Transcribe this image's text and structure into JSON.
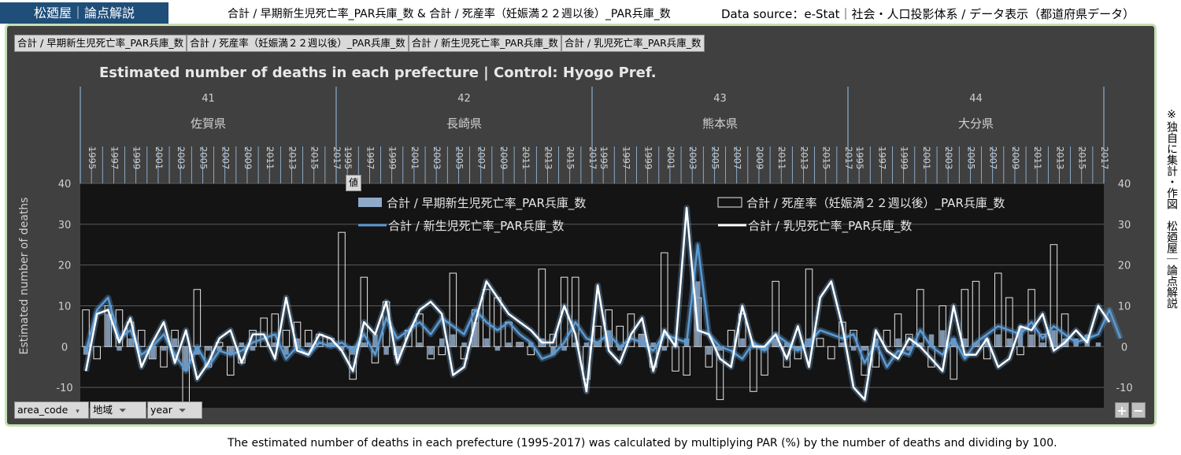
{
  "header": {
    "brand": "松廼屋｜論点解説",
    "fields": "合計 / 早期新生児死亡率_PAR兵庫_数 & 合計 / 死産率（妊娠満２２週以後）_PAR兵庫_数",
    "source": "Data source：e-Stat｜社会・人口投影体系 / データ表示（都道府県データ）"
  },
  "field_buttons": [
    "合計 / 早期新生児死亡率_PAR兵庫_数",
    "合計 / 死産率（妊娠満２２週以後）_PAR兵庫_数",
    "合計 / 新生児死亡率_PAR兵庫_数",
    "合計 / 乳児死亡率_PAR兵庫_数"
  ],
  "values_tag": "値",
  "side_credit": "※独自に集計・作図　松廼屋｜論点解説",
  "footnote": "The estimated number of deaths in each prefecture (1995-2017) was calculated by multiplying PAR (%) by the number of deaths and dividing by 100.",
  "bottom_buttons": {
    "area_code": "area_code",
    "region": "地域",
    "year": "year"
  },
  "zoom": {
    "plus": "+",
    "minus": "−"
  },
  "colors": {
    "panel": "#404040",
    "plot": "#141414",
    "bar_early": "#8fa9c9",
    "line_neonatal": "#5b9bd5",
    "line_infant": "#ffffff",
    "axis_line": "#9dc3e6"
  },
  "chart_data": {
    "type": "bar",
    "title": "Estimated number of deaths in each prefecture | Control: Hyogo Pref.",
    "ylabel": "Estimated number of deaths",
    "ylim": [
      -15,
      40
    ],
    "yticks": [
      40,
      30,
      20,
      10,
      0,
      -10
    ],
    "secondary_yticks": [
      40,
      30,
      20,
      10,
      0,
      -10
    ],
    "legend_position": "top",
    "groups": [
      {
        "code": "41",
        "name": "佐賀県",
        "years": [
          "1995",
          "1996",
          "1997",
          "1998",
          "1999",
          "2000",
          "2001",
          "2002",
          "2003",
          "2004",
          "2005",
          "2006",
          "2007",
          "2008",
          "2009",
          "2010",
          "2011",
          "2012",
          "2013",
          "2014",
          "2015",
          "2016",
          "2017"
        ]
      },
      {
        "code": "42",
        "name": "長崎県",
        "years": [
          "1995",
          "1996",
          "1997",
          "1998",
          "1999",
          "2000",
          "2001",
          "2002",
          "2003",
          "2004",
          "2005",
          "2006",
          "2007",
          "2008",
          "2009",
          "2010",
          "2011",
          "2012",
          "2013",
          "2014",
          "2015",
          "2016",
          "2017"
        ]
      },
      {
        "code": "43",
        "name": "熊本県",
        "years": [
          "1995",
          "1996",
          "1997",
          "1998",
          "1999",
          "2000",
          "2001",
          "2002",
          "2003",
          "2004",
          "2005",
          "2006",
          "2007",
          "2008",
          "2009",
          "2010",
          "2011",
          "2012",
          "2013",
          "2014",
          "2015",
          "2016",
          "2017"
        ]
      },
      {
        "code": "44",
        "name": "大分県",
        "years": [
          "1995",
          "1996",
          "1997",
          "1998",
          "1999",
          "2000",
          "2001",
          "2002",
          "2003",
          "2004",
          "2005",
          "2006",
          "2007",
          "2008",
          "2009",
          "2010",
          "2011",
          "2012",
          "2013",
          "2014",
          "2015",
          "2016",
          "2017"
        ]
      }
    ],
    "series": [
      {
        "name": "合計 / 早期新生児死亡率_PAR兵庫_数",
        "kind": "bar",
        "values": [
          -2,
          0,
          8,
          -1,
          2,
          0,
          -3,
          -1,
          2,
          -6,
          -2,
          -1,
          -1,
          -2,
          1,
          -1,
          0,
          1,
          -2,
          2,
          1,
          0,
          1,
          -1,
          -2,
          1,
          3,
          -2,
          -3,
          0,
          1,
          -2,
          2,
          3,
          1,
          6,
          2,
          -1,
          1,
          1,
          1,
          2,
          -2,
          -1,
          1,
          1,
          1,
          4,
          -1,
          0,
          3,
          1,
          -1,
          1,
          2,
          16,
          -2,
          -1,
          0,
          2,
          1,
          -1,
          2,
          1,
          -1,
          2,
          0,
          0,
          1,
          -1,
          -1,
          2,
          0,
          2,
          -1,
          1,
          3,
          4,
          2,
          2,
          1,
          2,
          3,
          2,
          5,
          3,
          1,
          4,
          2,
          2,
          3,
          1
        ]
      },
      {
        "name": "合計 / 死産率（妊娠満２２週以後）_PAR兵庫_数",
        "kind": "bar-outline",
        "values": [
          9,
          -3,
          10,
          9,
          6,
          4,
          -3,
          -5,
          4,
          -14,
          14,
          -5,
          1,
          -7,
          -4,
          4,
          7,
          8,
          4,
          6,
          4,
          3,
          2,
          28,
          -8,
          17,
          -4,
          11,
          -2,
          4,
          8,
          -3,
          -2,
          18,
          -3,
          9,
          14,
          12,
          6,
          1,
          -2,
          19,
          3,
          17,
          17,
          -8,
          5,
          9,
          5,
          8,
          3,
          -5,
          23,
          -6,
          -7,
          12,
          -5,
          -13,
          4,
          8,
          -11,
          -7,
          16,
          -5,
          -3,
          19,
          2,
          -3,
          6,
          4,
          -7,
          -5,
          4,
          8,
          3,
          14,
          -5,
          10,
          -8,
          14,
          16,
          -3,
          18,
          12,
          -2,
          14,
          3,
          25,
          8
        ]
      },
      {
        "name": "合計 / 新生児死亡率_PAR兵庫_数",
        "kind": "line",
        "values": [
          -1,
          9,
          12,
          2,
          4,
          -2,
          0,
          3,
          -2,
          -6,
          0,
          -5,
          -1,
          -2,
          -1,
          1,
          2,
          3,
          -3,
          0,
          -2,
          1,
          0,
          1,
          -1,
          3,
          -2,
          7,
          2,
          4,
          6,
          3,
          7,
          5,
          3,
          9,
          6,
          4,
          6,
          3,
          1,
          -3,
          -2,
          1,
          6,
          2,
          1,
          3,
          0,
          2,
          1,
          -1,
          3,
          2,
          1,
          25,
          3,
          0,
          -1,
          -3,
          1,
          -1,
          3,
          1,
          -1,
          1,
          4,
          3,
          2,
          3,
          -4,
          1,
          -5,
          -1,
          -2,
          4,
          0,
          -2,
          2,
          -3,
          1,
          3,
          5,
          4,
          3,
          6,
          2,
          5,
          3,
          1,
          2,
          3,
          9,
          2
        ]
      },
      {
        "name": "合計 / 乳児死亡率_PAR兵庫_数",
        "kind": "line",
        "values": [
          -6,
          8,
          9,
          1,
          7,
          -5,
          1,
          6,
          -4,
          4,
          -8,
          -4,
          2,
          4,
          -4,
          3,
          3,
          -3,
          12,
          -1,
          -2,
          3,
          2,
          -1,
          -6,
          6,
          3,
          11,
          -4,
          3,
          9,
          11,
          8,
          -7,
          -5,
          6,
          16,
          12,
          8,
          6,
          4,
          1,
          1,
          10,
          3,
          -11,
          15,
          -1,
          -4,
          3,
          7,
          -6,
          4,
          0,
          34,
          4,
          3,
          -3,
          -5,
          10,
          0,
          0,
          3,
          -3,
          5,
          -5,
          12,
          16,
          5,
          -10,
          -13,
          4,
          -1,
          -3,
          2,
          0,
          -3,
          -6,
          10,
          -2,
          -2,
          2,
          -5,
          -3,
          5,
          4,
          8,
          -1,
          1,
          4,
          1,
          10,
          6
        ]
      }
    ]
  }
}
